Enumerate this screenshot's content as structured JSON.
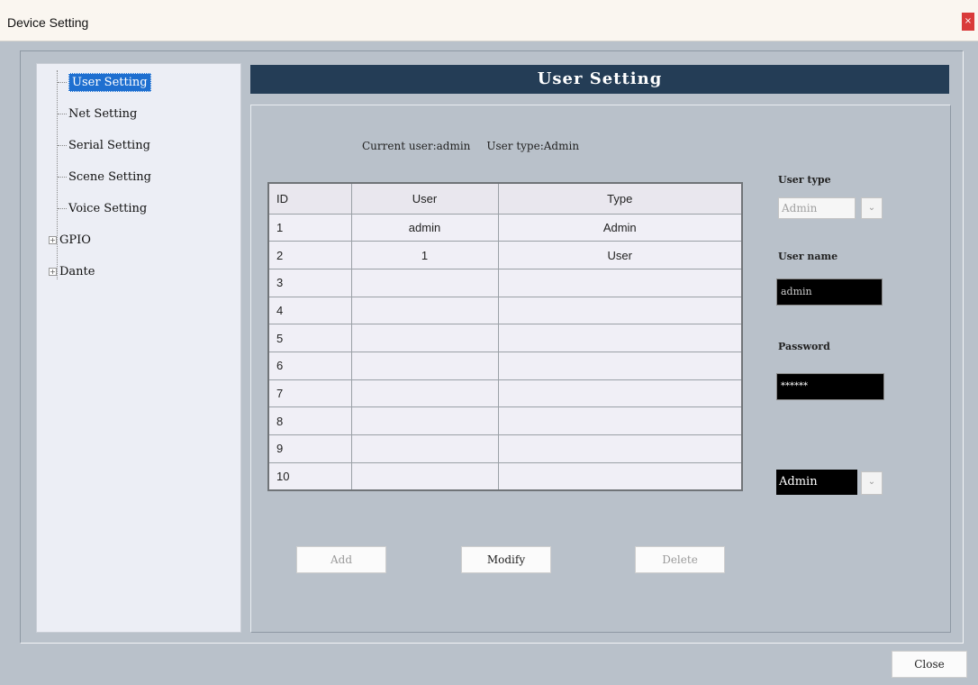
{
  "window": {
    "title": "Device Setting",
    "close_glyph": "×",
    "close_button_label": "Close"
  },
  "sidebar": {
    "items": [
      {
        "label": "User Setting",
        "selected": true
      },
      {
        "label": "Net Setting"
      },
      {
        "label": "Serial Setting"
      },
      {
        "label": "Scene Setting"
      },
      {
        "label": "Voice Setting"
      },
      {
        "label": "GPIO",
        "expandable": true
      },
      {
        "label": "Dante",
        "expandable": true
      }
    ],
    "expander_glyph": "+"
  },
  "header": {
    "title": "User Setting"
  },
  "current_user": {
    "user_text": "Current user:admin",
    "type_text": "User type:Admin"
  },
  "table": {
    "columns": [
      "ID",
      "User",
      "Type"
    ],
    "rows": [
      {
        "id": "1",
        "user": "admin",
        "type": "Admin"
      },
      {
        "id": "2",
        "user": "1",
        "type": "User"
      },
      {
        "id": "3",
        "user": "",
        "type": ""
      },
      {
        "id": "4",
        "user": "",
        "type": ""
      },
      {
        "id": "5",
        "user": "",
        "type": ""
      },
      {
        "id": "6",
        "user": "",
        "type": ""
      },
      {
        "id": "7",
        "user": "",
        "type": ""
      },
      {
        "id": "8",
        "user": "",
        "type": ""
      },
      {
        "id": "9",
        "user": "",
        "type": ""
      },
      {
        "id": "10",
        "user": "",
        "type": ""
      }
    ]
  },
  "form": {
    "user_type_label": "User type",
    "user_type_value": "Admin",
    "user_name_label": "User name",
    "user_name_value": "admin",
    "password_label": "Password",
    "password_value": "******",
    "type_select_value": "Admin",
    "dropdown_glyph": "⌄"
  },
  "buttons": {
    "add": "Add",
    "modify": "Modify",
    "delete": "Delete"
  },
  "colors": {
    "header_bg": "#243d56",
    "selection": "#1e6fd0",
    "window_bg": "#b9c1ca"
  }
}
